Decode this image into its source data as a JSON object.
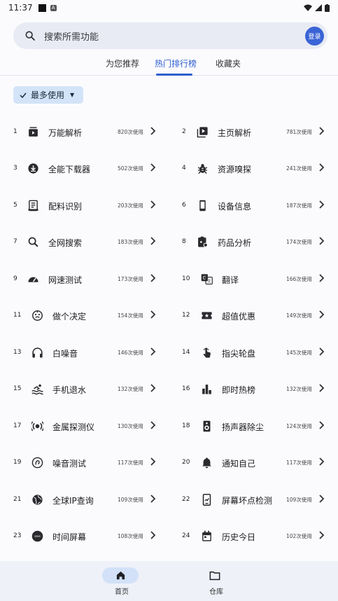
{
  "status_bar": {
    "time": "11:37"
  },
  "search": {
    "placeholder": "搜索所需功能",
    "login_label": "登录"
  },
  "tabs": [
    {
      "label": "为您推荐"
    },
    {
      "label": "热门排行榜"
    },
    {
      "label": "收藏夹"
    }
  ],
  "filter": {
    "label": "最多使用"
  },
  "items": [
    {
      "rank": "1",
      "name": "万能解析",
      "usage": "820次使用",
      "icon": "video-download-icon"
    },
    {
      "rank": "2",
      "name": "主页解析",
      "usage": "781次使用",
      "icon": "video-library-icon"
    },
    {
      "rank": "3",
      "name": "全能下载器",
      "usage": "502次使用",
      "icon": "download-icon"
    },
    {
      "rank": "4",
      "name": "资源嗅探",
      "usage": "241次使用",
      "icon": "bug-icon"
    },
    {
      "rank": "5",
      "name": "配料识别",
      "usage": "203次使用",
      "icon": "article-icon"
    },
    {
      "rank": "6",
      "name": "设备信息",
      "usage": "187次使用",
      "icon": "phone-icon"
    },
    {
      "rank": "7",
      "name": "全网搜索",
      "usage": "183次使用",
      "icon": "search-icon"
    },
    {
      "rank": "8",
      "name": "药品分析",
      "usage": "174次使用",
      "icon": "medical-clipboard-icon"
    },
    {
      "rank": "9",
      "name": "网速测试",
      "usage": "173次使用",
      "icon": "speedometer-icon"
    },
    {
      "rank": "10",
      "name": "翻译",
      "usage": "166次使用",
      "icon": "translate-icon"
    },
    {
      "rank": "11",
      "name": "做个决定",
      "usage": "154次使用",
      "icon": "face-icon"
    },
    {
      "rank": "12",
      "name": "超值优惠",
      "usage": "149次使用",
      "icon": "ticket-icon"
    },
    {
      "rank": "13",
      "name": "白噪音",
      "usage": "146次使用",
      "icon": "headphones-icon"
    },
    {
      "rank": "14",
      "name": "指尖轮盘",
      "usage": "145次使用",
      "icon": "touch-icon"
    },
    {
      "rank": "15",
      "name": "手机退水",
      "usage": "132次使用",
      "icon": "swim-icon"
    },
    {
      "rank": "16",
      "name": "即时热榜",
      "usage": "132次使用",
      "icon": "bar-chart-icon"
    },
    {
      "rank": "17",
      "name": "金属探测仪",
      "usage": "130次使用",
      "icon": "sensor-icon"
    },
    {
      "rank": "18",
      "name": "扬声器除尘",
      "usage": "124次使用",
      "icon": "speaker-icon"
    },
    {
      "rank": "19",
      "name": "噪音测试",
      "usage": "117次使用",
      "icon": "hearing-icon"
    },
    {
      "rank": "20",
      "name": "通知自己",
      "usage": "117次使用",
      "icon": "bell-icon"
    },
    {
      "rank": "21",
      "name": "全球IP查询",
      "usage": "109次使用",
      "icon": "globe-icon"
    },
    {
      "rank": "22",
      "name": "屏幕坏点检测",
      "usage": "109次使用",
      "icon": "screen-check-icon"
    },
    {
      "rank": "23",
      "name": "时间屏幕",
      "usage": "108次使用",
      "icon": "clock-badge-icon"
    },
    {
      "rank": "24",
      "name": "历史今日",
      "usage": "102次使用",
      "icon": "calendar-icon"
    }
  ],
  "bottom_nav": [
    {
      "label": "首页"
    },
    {
      "label": "仓库"
    }
  ],
  "colors": {
    "accent": "#2f5fcf",
    "login": "#3a63d6",
    "chip": "#d4e4f8"
  }
}
